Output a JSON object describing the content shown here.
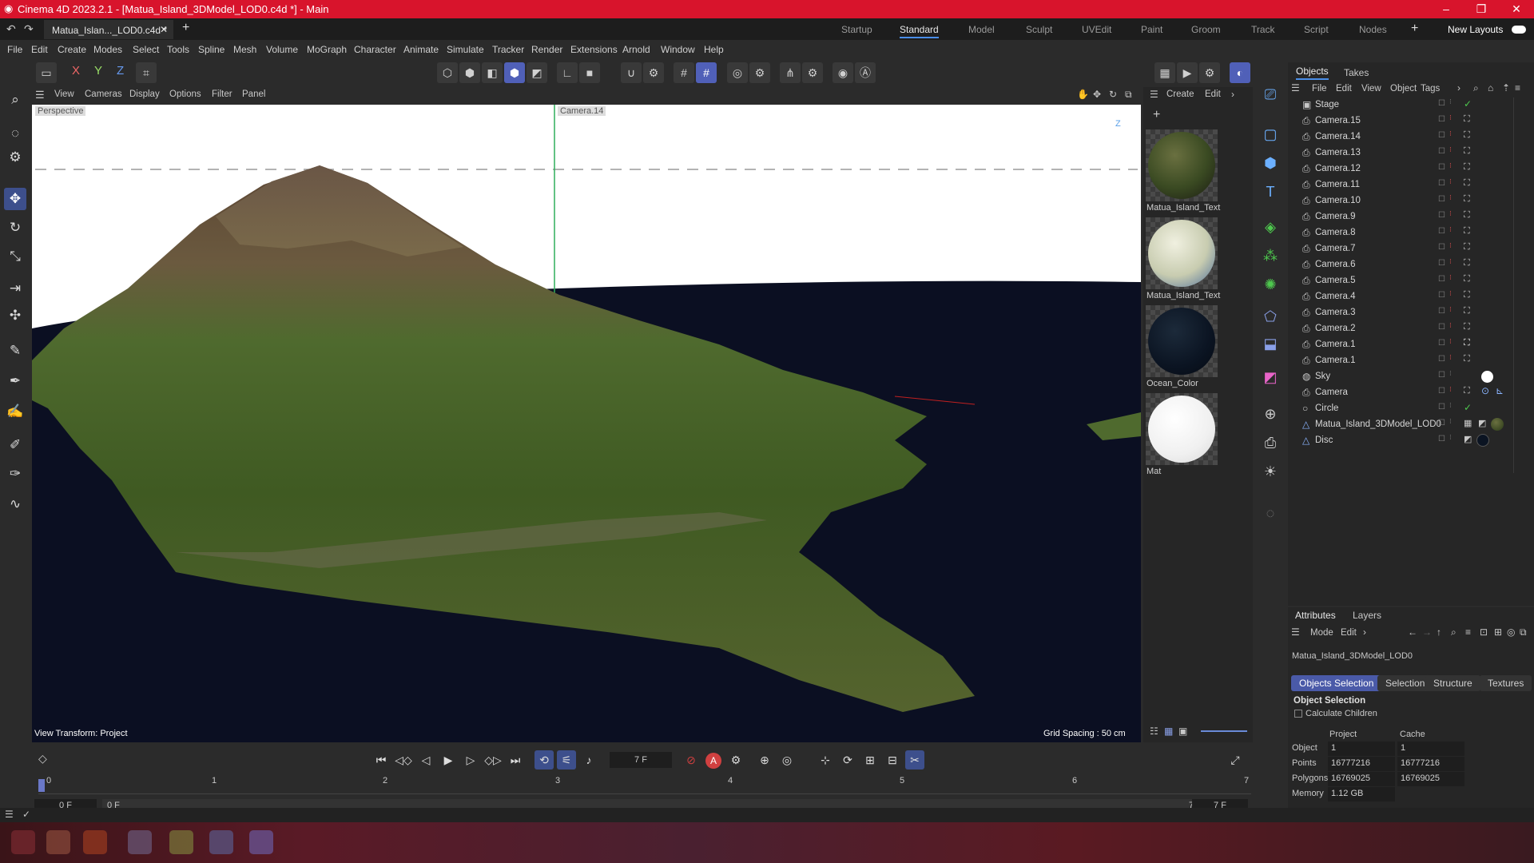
{
  "window": {
    "title": "Cinema 4D 2023.2.1 - [Matua_Island_3DModel_LOD0.c4d *] - Main",
    "doc_tab": "Matua_Islan..._LOD0.c4d *",
    "controls": {
      "minimize": "–",
      "restore": "❐",
      "close": "✕"
    }
  },
  "layouts": [
    "Startup",
    "Standard",
    "Model",
    "Sculpt",
    "UVEdit",
    "Paint",
    "Groom",
    "Track",
    "Script",
    "Nodes"
  ],
  "active_layout": "Standard",
  "new_layouts_label": "New Layouts",
  "menu": [
    "File",
    "Edit",
    "Create",
    "Modes",
    "Select",
    "Tools",
    "Spline",
    "Mesh",
    "Volume",
    "MoGraph",
    "Character",
    "Animate",
    "Simulate",
    "Tracker",
    "Render",
    "Extensions",
    "Arnold",
    "Window",
    "Help"
  ],
  "axis_lock": [
    "X",
    "Y",
    "Z"
  ],
  "viewport": {
    "menu": [
      "View",
      "Cameras",
      "Display",
      "Options",
      "Filter",
      "Panel"
    ],
    "camera_label": "Perspective",
    "camera_label_2": "Camera.14",
    "tool_label": "Move ✢",
    "view_transform": "View Transform: Project",
    "grid_spacing": "Grid Spacing : 50 cm",
    "axis_gizmo": "Z"
  },
  "materials": {
    "menu": [
      "Create",
      "Edit"
    ],
    "items": [
      {
        "name": "Matua_Island_Text"
      },
      {
        "name": "Matua_Island_Text"
      },
      {
        "name": "Ocean_Color"
      },
      {
        "name": "Mat"
      }
    ]
  },
  "objects": {
    "tabs": [
      "Objects",
      "Takes"
    ],
    "menu": [
      "File",
      "Edit",
      "View",
      "Object",
      "Tags"
    ],
    "items": [
      {
        "name": "Stage",
        "icon": "stage-icon"
      },
      {
        "name": "Camera.15",
        "icon": "camera-icon"
      },
      {
        "name": "Camera.14",
        "icon": "camera-icon"
      },
      {
        "name": "Camera.13",
        "icon": "camera-icon"
      },
      {
        "name": "Camera.12",
        "icon": "camera-icon"
      },
      {
        "name": "Camera.11",
        "icon": "camera-icon"
      },
      {
        "name": "Camera.10",
        "icon": "camera-icon"
      },
      {
        "name": "Camera.9",
        "icon": "camera-icon"
      },
      {
        "name": "Camera.8",
        "icon": "camera-icon"
      },
      {
        "name": "Camera.7",
        "icon": "camera-icon"
      },
      {
        "name": "Camera.6",
        "icon": "camera-icon"
      },
      {
        "name": "Camera.5",
        "icon": "camera-icon"
      },
      {
        "name": "Camera.4",
        "icon": "camera-icon"
      },
      {
        "name": "Camera.3",
        "icon": "camera-icon"
      },
      {
        "name": "Camera.2",
        "icon": "camera-icon"
      },
      {
        "name": "Camera.1",
        "icon": "camera-icon"
      },
      {
        "name": "Camera.1",
        "icon": "camera-icon"
      },
      {
        "name": "Sky",
        "icon": "sky-icon"
      },
      {
        "name": "Camera",
        "icon": "camera-icon"
      },
      {
        "name": "Circle",
        "icon": "circle-icon"
      },
      {
        "name": "Matua_Island_3DModel_LOD0",
        "icon": "polygon-object-icon"
      },
      {
        "name": "Disc",
        "icon": "polygon-object-icon"
      }
    ]
  },
  "attributes": {
    "tabs": [
      "Attributes",
      "Layers"
    ],
    "menu": [
      "Mode",
      "Edit"
    ],
    "object_name": "Matua_Island_3DModel_LOD0",
    "subtabs": [
      "Objects Selection",
      "Selection",
      "Structure",
      "Textures"
    ],
    "section_title": "Object Selection",
    "checkbox_label": "Calculate Children",
    "columns": [
      "Project",
      "Cache"
    ],
    "rows": [
      {
        "label": "Object",
        "project": "1",
        "cache": "1"
      },
      {
        "label": "Points",
        "project": "16777216",
        "cache": "16777216"
      },
      {
        "label": "Polygons",
        "project": "16769025",
        "cache": "16769025"
      },
      {
        "label": "Memory",
        "project": "1.12 GB",
        "cache": ""
      }
    ]
  },
  "timeline": {
    "current_frame": "7 F",
    "ruler": [
      "0",
      "1",
      "2",
      "3",
      "4",
      "5",
      "6",
      "7"
    ],
    "start": "0 F",
    "range_start": "0 F",
    "range_end": "7 F",
    "end": "7 F"
  },
  "colors": {
    "accent": "#4a5aa8",
    "title_bar": "#d8142c",
    "ocean": "#0b0f22"
  }
}
